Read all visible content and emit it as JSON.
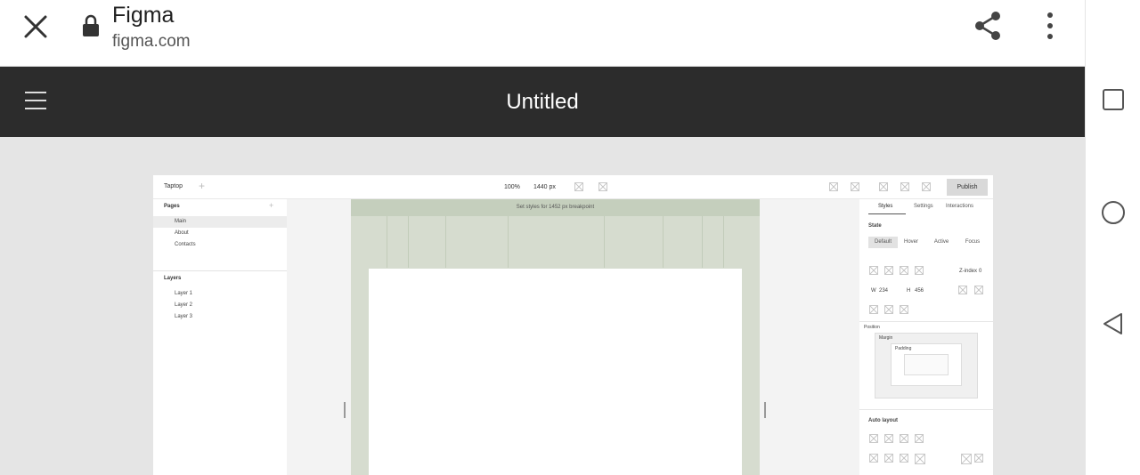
{
  "browser": {
    "site_title": "Figma",
    "site_url": "figma.com"
  },
  "app": {
    "title": "Untitled"
  },
  "editor": {
    "breakpoint_name": "Taptop",
    "zoom": "100%",
    "width": "1440 px",
    "publish_label": "Publish",
    "pages_heading": "Pages",
    "pages": [
      "Main",
      "About",
      "Contacts"
    ],
    "layers_heading": "Layers",
    "layers": [
      "Layer 1",
      "Layer 2",
      "Layer 3"
    ],
    "breakpoint_hint": "Set styles for 1452 px breakpoint",
    "tabs": [
      "Styles",
      "Settings",
      "Interactions"
    ],
    "state_label": "State",
    "states": [
      "Default",
      "Hover",
      "Active",
      "Focus"
    ],
    "zindex_label": "Z-index",
    "zindex_value": "0",
    "w_label": "W",
    "w_value": "234",
    "h_label": "H",
    "h_value": "456",
    "position_label": "Position",
    "margin_label": "Margin",
    "padding_label": "Padding",
    "auto_layout_label": "Auto layout"
  }
}
